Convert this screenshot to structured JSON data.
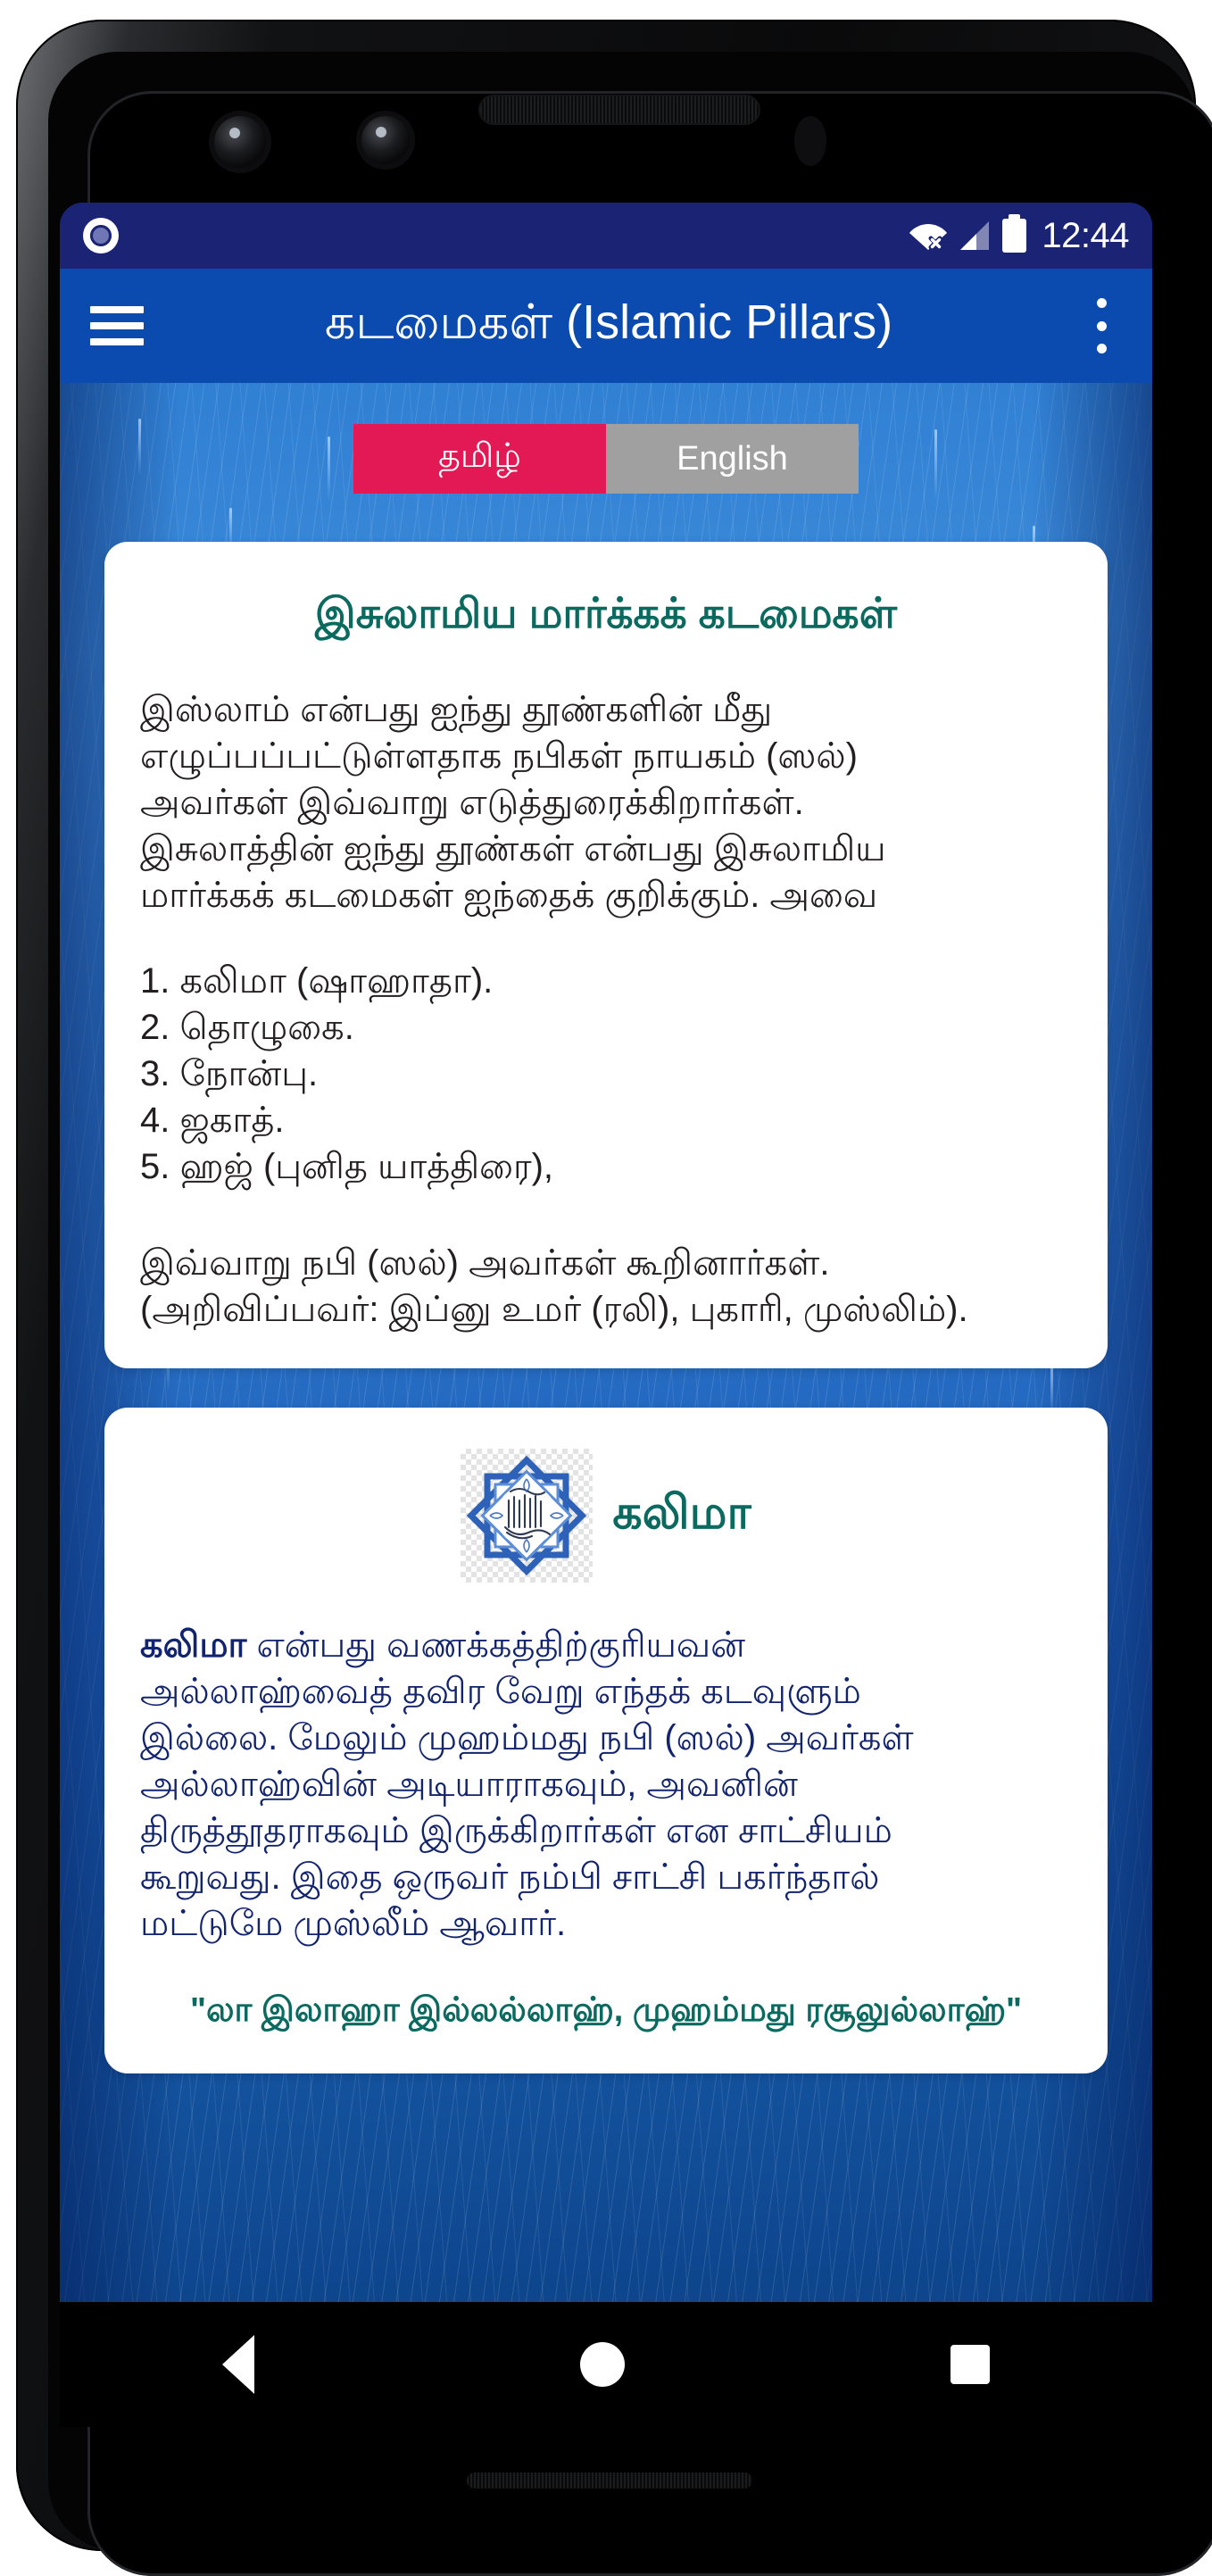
{
  "statusbar": {
    "notification_icon": "circle-notification-icon",
    "wifi_icon": "wifi-off-icon",
    "signal_icon": "signal-bars-icon",
    "battery_icon": "battery-full-icon",
    "time": "12:44"
  },
  "appbar": {
    "menu_icon": "hamburger-menu-icon",
    "title": "கடமைகள் (Islamic Pillars)",
    "overflow_icon": "more-vertical-icon",
    "background_color": "#0b4bb0"
  },
  "tabs": [
    {
      "label": "தமிழ்",
      "active": true,
      "color": "#e31955"
    },
    {
      "label": "English",
      "active": false,
      "color": "#a0a0a0"
    }
  ],
  "cards": [
    {
      "title": "இசுலாமிய மார்க்கக் கடமைகள்",
      "title_color": "#0b6a5f",
      "paragraph": "இஸ்லாம் என்பது ஐந்து தூண்களின் மீது\nஎழுப்பப்பட்டுள்ளதாக நபிகள் நாயகம் (ஸல்)\nஅவர்கள் இவ்வாறு எடுத்துரைக்கிறார்கள்.\nஇசுலாத்தின் ஐந்து தூண்கள் என்பது இசுலாமிய\nமார்க்கக் கடமைகள் ஐந்தைக் குறிக்கும். அவை",
      "list": "1. கலிமா (ஷாஹாதா).\n2. தொழுகை.\n3. நோன்பு.\n4. ஜகாத்.\n5. ஹஜ் (புனித யாத்திரை),",
      "closing": "இவ்வாறு நபி (ஸல்) அவர்கள் கூறினார்கள்.\n(அறிவிப்பவர்: இப்னு உமர் (ரலி), புகாரி, முஸ்லிம்)."
    },
    {
      "emblem_icon": "islamic-calligraphy-star-emblem",
      "title": "கலிமா",
      "title_color": "#0b6a5f",
      "lead_word": "கலிமா",
      "paragraph": " என்பது வணக்கத்திற்குரியவன்\nஅல்லாஹ்வைத் தவிர வேறு எந்தக் கடவுளும்\nஇல்லை. மேலும் முஹம்மது நபி (ஸல்) அவர்கள்\nஅல்லாஹ்வின் அடியாராகவும், அவனின்\nதிருத்தூதராகவும் இருக்கிறார்கள் என சாட்சியம்\nகூறுவது. இதை ஒருவர் நம்பி சாட்சி பகர்ந்தால்\nமட்டுமே முஸ்லீம் ஆவார்.",
      "text_color": "#12246e",
      "quote": "\"லா இலாஹா இல்லல்லாஹ், முஹம்மது ரசூலுல்லாஹ்\"",
      "quote_color": "#0b6a5f"
    }
  ],
  "navbar": {
    "back_icon": "back-triangle-icon",
    "home_icon": "home-circle-icon",
    "recents_icon": "recents-square-icon"
  }
}
